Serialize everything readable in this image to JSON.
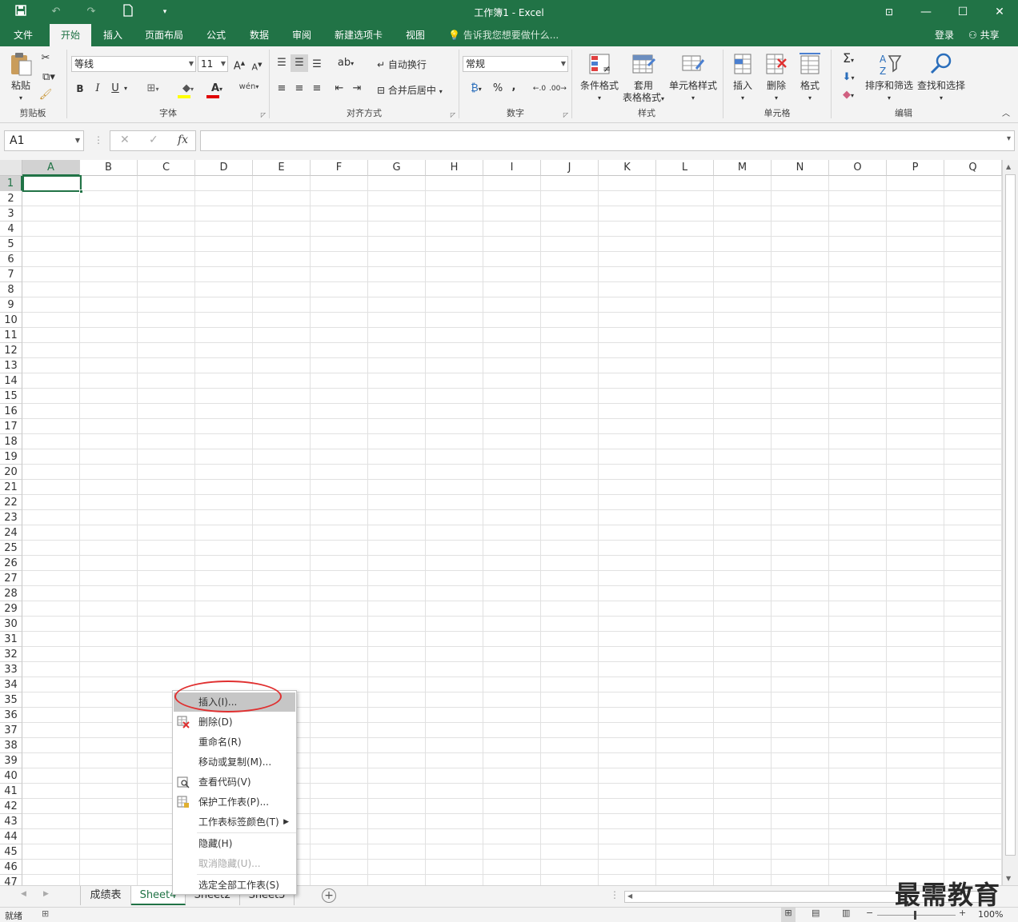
{
  "window": {
    "title": "工作簿1 - Excel"
  },
  "ribbon_tabs": [
    "文件",
    "开始",
    "插入",
    "页面布局",
    "公式",
    "数据",
    "审阅",
    "新建选项卡",
    "视图"
  ],
  "tell_me": "告诉我您想要做什么...",
  "account": {
    "signin": "登录",
    "share": "共享"
  },
  "groups": {
    "clipboard": {
      "label": "剪贴板",
      "paste": "粘贴"
    },
    "font": {
      "label": "字体",
      "font_name": "等线",
      "font_size": "11",
      "bold": "B",
      "italic": "I",
      "underline": "U"
    },
    "alignment": {
      "label": "对齐方式",
      "wrap": "自动换行",
      "merge": "合并后居中"
    },
    "number": {
      "label": "数字",
      "format": "常规",
      "percent": "%",
      "comma": ","
    },
    "styles": {
      "label": "样式",
      "conditional": "条件格式",
      "table_line1": "套用",
      "table_line2": "表格格式",
      "cell_styles": "单元格样式"
    },
    "cells": {
      "label": "单元格",
      "insert": "插入",
      "delete": "删除",
      "format": "格式"
    },
    "editing": {
      "label": "编辑",
      "sort": "排序和筛选",
      "find": "查找和选择"
    }
  },
  "formula_bar": {
    "name_box": "A1",
    "fx": "fx",
    "value": ""
  },
  "columns": [
    "A",
    "B",
    "C",
    "D",
    "E",
    "F",
    "G",
    "H",
    "I",
    "J",
    "K",
    "L",
    "M",
    "N",
    "O",
    "P",
    "Q"
  ],
  "rows": [
    "1",
    "2",
    "3",
    "4",
    "5",
    "6",
    "7",
    "8",
    "9",
    "10",
    "11",
    "12",
    "13",
    "14",
    "15",
    "16",
    "17",
    "18",
    "19",
    "20",
    "21",
    "22",
    "23",
    "24",
    "25",
    "26",
    "27",
    "28",
    "29",
    "30",
    "31",
    "32",
    "33",
    "34",
    "35",
    "36",
    "37",
    "38",
    "39",
    "40",
    "41",
    "42",
    "43",
    "44",
    "45",
    "46",
    "47"
  ],
  "sheets": [
    "成绩表",
    "Sheet4",
    "Sheet2",
    "Sheet3"
  ],
  "status": {
    "ready": "就绪",
    "zoom": "100%"
  },
  "context_menu": [
    "插入(I)...",
    "删除(D)",
    "重命名(R)",
    "移动或复制(M)...",
    "查看代码(V)",
    "保护工作表(P)...",
    "工作表标签颜色(T)",
    "隐藏(H)",
    "取消隐藏(U)...",
    "选定全部工作表(S)"
  ],
  "watermark": "最需教育",
  "colors": {
    "accent": "#217346",
    "highlight_circle": "#e03030"
  }
}
